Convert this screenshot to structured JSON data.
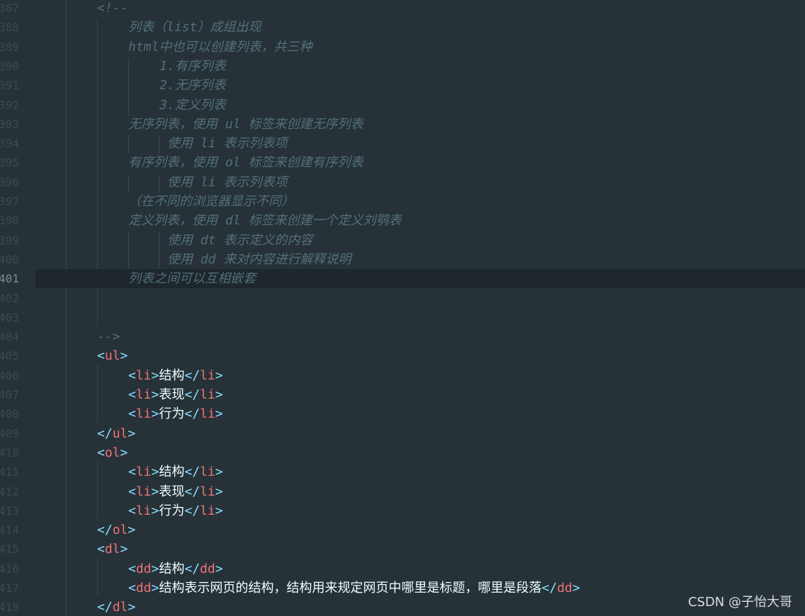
{
  "editor": {
    "current_line": "401",
    "lines": [
      {
        "n": "387",
        "indent": 0,
        "kind": "comment",
        "text": "<!--"
      },
      {
        "n": "388",
        "indent": 1,
        "kind": "comment",
        "text": "列表（list）成组出现"
      },
      {
        "n": "389",
        "indent": 1,
        "kind": "comment",
        "text": "html中也可以创建列表，共三种"
      },
      {
        "n": "390",
        "indent": 2,
        "kind": "comment",
        "text": "1.有序列表"
      },
      {
        "n": "391",
        "indent": 2,
        "kind": "comment",
        "text": "2.无序列表"
      },
      {
        "n": "392",
        "indent": 2,
        "kind": "comment",
        "text": "3.定义列表"
      },
      {
        "n": "393",
        "indent": 1,
        "kind": "comment",
        "text": "无序列表，使用 ul 标签来创建无序列表"
      },
      {
        "n": "394",
        "indent": 2.25,
        "kind": "comment",
        "text": "使用 li 表示列表项"
      },
      {
        "n": "395",
        "indent": 1,
        "kind": "comment",
        "text": "有序列表，使用 ol 标签来创建有序列表"
      },
      {
        "n": "396",
        "indent": 2.25,
        "kind": "comment",
        "text": "使用 li 表示列表项"
      },
      {
        "n": "397",
        "indent": 1,
        "kind": "comment",
        "text": "（在不同的浏览器显示不同）"
      },
      {
        "n": "398",
        "indent": 1,
        "kind": "comment",
        "text": "定义列表，使用 dl 标签来创建一个定义刘鹗表"
      },
      {
        "n": "399",
        "indent": 2.25,
        "kind": "comment",
        "text": "使用 dt 表示定义的内容"
      },
      {
        "n": "400",
        "indent": 2.25,
        "kind": "comment",
        "text": "使用 dd 来对内容进行解释说明"
      },
      {
        "n": "401",
        "indent": 1,
        "kind": "comment",
        "text": "列表之间可以互相嵌套"
      },
      {
        "n": "402",
        "indent": 0,
        "kind": "blank",
        "text": ""
      },
      {
        "n": "403",
        "indent": 0,
        "kind": "blank",
        "text": ""
      },
      {
        "n": "404",
        "indent": 0,
        "kind": "comment",
        "text": "-->"
      },
      {
        "n": "405",
        "indent": 0,
        "kind": "open",
        "tag": "ul"
      },
      {
        "n": "406",
        "indent": 1,
        "kind": "element",
        "tag": "li",
        "text": "结构"
      },
      {
        "n": "407",
        "indent": 1,
        "kind": "element",
        "tag": "li",
        "text": "表现"
      },
      {
        "n": "408",
        "indent": 1,
        "kind": "element",
        "tag": "li",
        "text": "行为"
      },
      {
        "n": "409",
        "indent": 0,
        "kind": "close",
        "tag": "ul"
      },
      {
        "n": "410",
        "indent": 0,
        "kind": "open",
        "tag": "ol"
      },
      {
        "n": "411",
        "indent": 1,
        "kind": "element",
        "tag": "li",
        "text": "结构"
      },
      {
        "n": "412",
        "indent": 1,
        "kind": "element",
        "tag": "li",
        "text": "表现"
      },
      {
        "n": "413",
        "indent": 1,
        "kind": "element",
        "tag": "li",
        "text": "行为"
      },
      {
        "n": "414",
        "indent": 0,
        "kind": "close",
        "tag": "ol"
      },
      {
        "n": "415",
        "indent": 0,
        "kind": "open",
        "tag": "dl"
      },
      {
        "n": "416",
        "indent": 1,
        "kind": "element",
        "tag": "dd",
        "text": "结构"
      },
      {
        "n": "417",
        "indent": 1,
        "kind": "element",
        "tag": "dd",
        "text": "结构表示网页的结构，结构用来规定网页中哪里是标题，哪里是段落"
      },
      {
        "n": "418",
        "indent": 0,
        "kind": "close",
        "tag": "dl"
      }
    ]
  },
  "watermark": "CSDN @子怡大哥",
  "colors": {
    "background": "#263238",
    "comment": "#546e7a",
    "punctuation": "#89ddff",
    "tag": "#f07178",
    "text": "#eeffff",
    "gutter": "#3b4a51"
  }
}
